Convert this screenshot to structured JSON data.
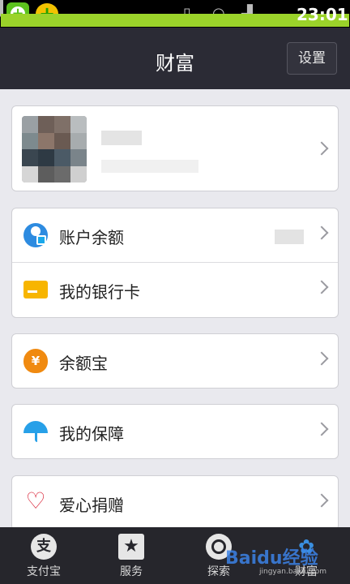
{
  "status_bar": {
    "time": "23:01",
    "icons": [
      "app-icon-1",
      "app-icon-2",
      "vibrate-icon",
      "wifi-icon",
      "signal-icon",
      "battery-icon"
    ]
  },
  "nav": {
    "title": "财富",
    "settings_label": "设置"
  },
  "profile": {
    "avatar": "avatar-image"
  },
  "account_group": {
    "items": [
      {
        "label": "账户余额",
        "icon": "user-balance-icon"
      },
      {
        "label": "我的银行卡",
        "icon": "bank-card-icon"
      }
    ]
  },
  "single_items": [
    {
      "label": "余额宝",
      "icon": "money-bag-icon"
    },
    {
      "label": "我的保障",
      "icon": "umbrella-icon"
    },
    {
      "label": "爱心捐赠",
      "icon": "heart-icon"
    }
  ],
  "tabbar": {
    "tabs": [
      {
        "label": "支付宝",
        "icon": "alipay-icon",
        "glyph": "支"
      },
      {
        "label": "服务",
        "icon": "star-icon",
        "glyph": "★"
      },
      {
        "label": "探索",
        "icon": "globe-icon",
        "glyph": ""
      },
      {
        "label": "财富",
        "icon": "paw-icon",
        "glyph": "✿"
      }
    ]
  },
  "watermark": {
    "text": "Baidu经验",
    "url": "jingyan.baidu.com"
  },
  "colors": {
    "nav_bg": "#2b2b35",
    "page_bg": "#e9e9ee",
    "tab_bg": "#26262c",
    "accent_blue": "#2d8be0",
    "accent_orange": "#f08a10",
    "accent_yellow": "#f7b500",
    "accent_red": "#d9263a"
  }
}
